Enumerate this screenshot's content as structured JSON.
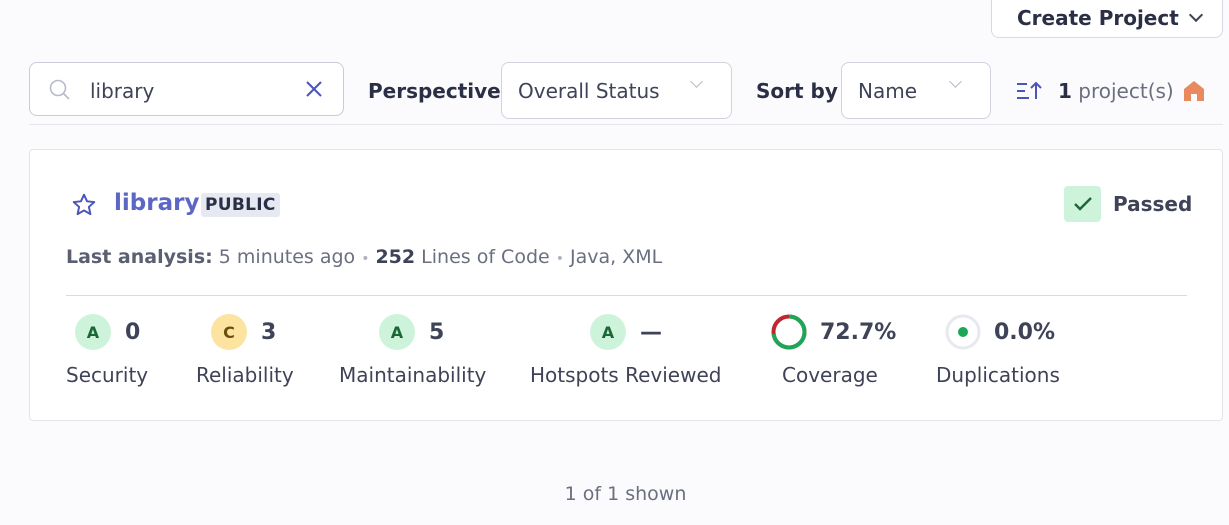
{
  "header": {
    "create_project_label": "Create Project"
  },
  "filters": {
    "search_value": "library",
    "perspective_label": "Perspective",
    "perspective_value": "Overall Status",
    "sort_label": "Sort by",
    "sort_value": "Name",
    "project_count": "1",
    "project_count_suffix": "project(s)"
  },
  "project": {
    "name": "library",
    "visibility": "PUBLIC",
    "quality_gate": "Passed",
    "last_analysis_label": "Last analysis:",
    "last_analysis_value": "5 minutes ago",
    "lines_of_code": "252",
    "lines_of_code_label": "Lines of Code",
    "languages": "Java, XML",
    "metrics": [
      {
        "grade": "A",
        "value": "0",
        "label": "Security"
      },
      {
        "grade": "C",
        "value": "3",
        "label": "Reliability"
      },
      {
        "grade": "A",
        "value": "5",
        "label": "Maintainability"
      },
      {
        "grade": "A",
        "value": "—",
        "label": "Hotspots Reviewed"
      }
    ],
    "coverage": {
      "value": "72.7%",
      "label": "Coverage",
      "fraction": 0.727
    },
    "duplications": {
      "value": "0.0%",
      "label": "Duplications"
    }
  },
  "footer": {
    "shown": "1 of 1 shown"
  },
  "colors": {
    "accent": "#5c67c4",
    "passed_bg": "#cdf3da",
    "passed_check": "#1d6636",
    "coverage_good": "#1aa857",
    "coverage_bad": "#c0272d"
  }
}
